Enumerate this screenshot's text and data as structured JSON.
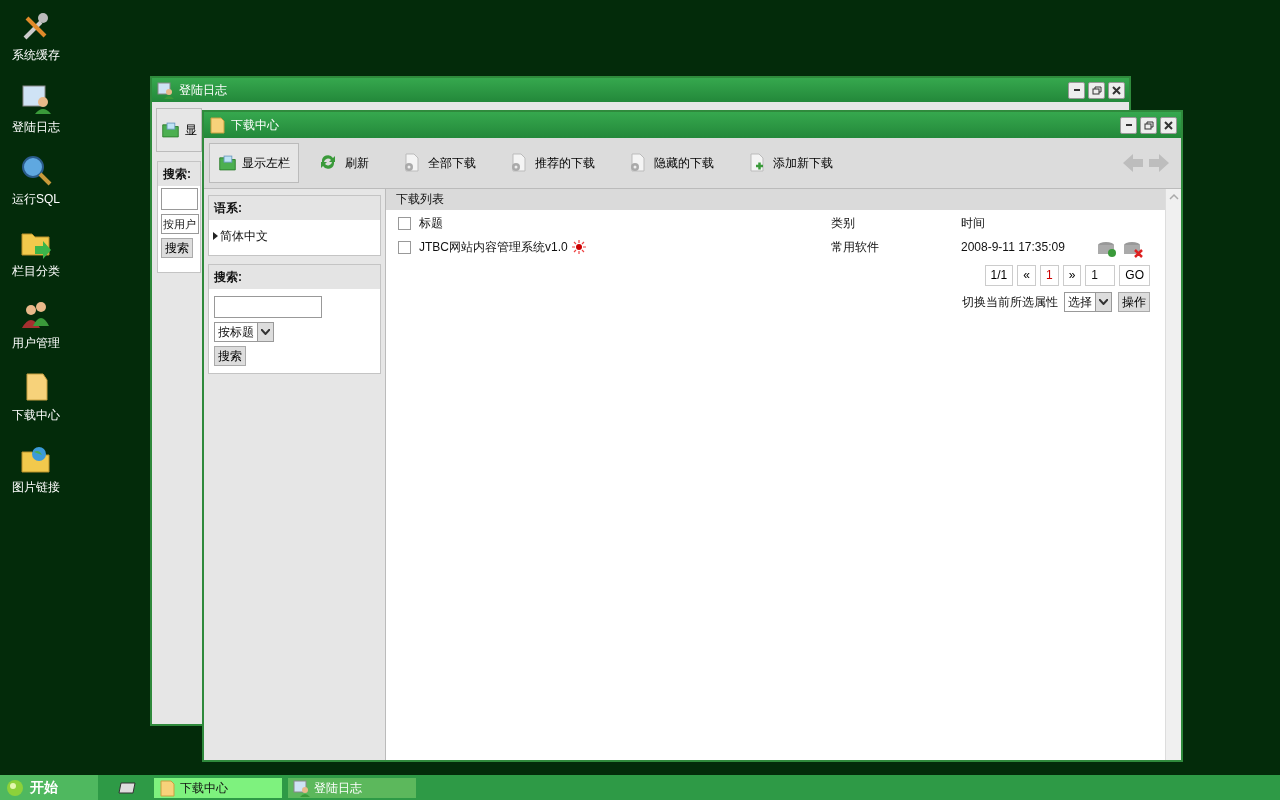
{
  "desktop_icons": [
    {
      "label": "系统缓存",
      "kind": "tools"
    },
    {
      "label": "登陆日志",
      "kind": "log"
    },
    {
      "label": "运行SQL",
      "kind": "sql"
    },
    {
      "label": "栏目分类",
      "kind": "category"
    },
    {
      "label": "用户管理",
      "kind": "users"
    },
    {
      "label": "下载中心",
      "kind": "download"
    },
    {
      "label": "图片链接",
      "kind": "images"
    }
  ],
  "back_window": {
    "title": "登陆日志",
    "toolbar_button": "显",
    "search_label": "搜索:",
    "search_select": "按用户",
    "search_button": "搜索"
  },
  "download_window": {
    "title": "下载中心",
    "toolbar": [
      {
        "label": "显示左栏",
        "kind": "folder",
        "selected": true
      },
      {
        "label": "刷新",
        "kind": "refresh",
        "selected": false
      },
      {
        "label": "全部下载",
        "kind": "gear",
        "selected": false
      },
      {
        "label": "推荐的下载",
        "kind": "gear",
        "selected": false
      },
      {
        "label": "隐藏的下载",
        "kind": "gear",
        "selected": false
      },
      {
        "label": "添加新下载",
        "kind": "add",
        "selected": false
      }
    ],
    "language_panel": {
      "title": "语系:",
      "items": [
        "简体中文"
      ]
    },
    "search_panel": {
      "title": "搜索:",
      "select": "按标题",
      "button": "搜索"
    },
    "list": {
      "title": "下载列表",
      "select_all_checked": false,
      "columns": [
        "标题",
        "类别",
        "时间"
      ],
      "rows": [
        {
          "title": "JTBC网站内容管理系统v1.0",
          "new": true,
          "category": "常用软件",
          "time": "2008-9-11 17:35:09",
          "checked": false
        }
      ]
    },
    "pager": [
      {
        "label": "1/1",
        "selected": false
      },
      {
        "label": "«",
        "selected": false
      },
      {
        "label": "1",
        "selected": true
      },
      {
        "label": "»",
        "selected": false
      }
    ],
    "page_input": "1",
    "go_button": "GO",
    "batch": {
      "label": "切换当前所选属性",
      "select": "选择",
      "button": "操作"
    }
  },
  "taskbar": {
    "start": "开始",
    "tasks": [
      {
        "label": "下载中心",
        "kind": "download",
        "selected": true
      },
      {
        "label": "登陆日志",
        "kind": "log",
        "selected": false
      }
    ]
  }
}
